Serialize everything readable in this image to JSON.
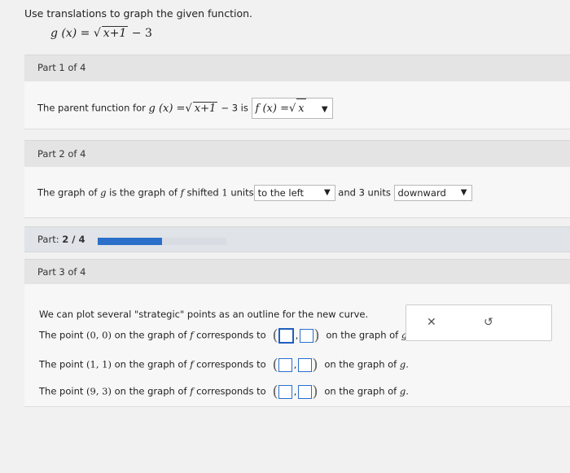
{
  "instructions": "Use translations to graph the given function.",
  "function": {
    "lhs": "g (x) =",
    "radicand": "x+1",
    "rest": "− 3"
  },
  "part1": {
    "label": "Part 1 of 4",
    "text_before": "The parent function for",
    "fn_lhs": "g (x) =",
    "fn_radicand": "x+1",
    "fn_rest": "− 3",
    "word_is": "is",
    "answer_lhs": "f (x) =",
    "answer_radicand": "x",
    "arrow": "▼"
  },
  "part2": {
    "label": "Part 2 of 4",
    "text_a": "The graph of",
    "var_g": "g",
    "text_b": "is the graph of",
    "var_f": "f",
    "text_c": "shifted",
    "h_units": "1",
    "text_d": "units",
    "h_direction": "to the left",
    "text_e": "and 3 units",
    "v_direction": "downward",
    "arrow": "▼"
  },
  "progress": {
    "label": "Part:",
    "value": "2 / 4",
    "fraction": 0.5
  },
  "part3": {
    "label": "Part 3 of 4",
    "intro": "We can plot several \"strategic\" points as an outline for the new curve.",
    "rows": [
      {
        "prefix": "The point",
        "point": "(0, 0)",
        "middle": "on the graph of",
        "fvar": "f",
        "corr": "corresponds to",
        "suffix": "on the graph of",
        "gvar": "g."
      },
      {
        "prefix": "The point",
        "point": "(1, 1)",
        "middle": "on the graph of",
        "fvar": "f",
        "corr": "corresponds to",
        "suffix": "on the graph of",
        "gvar": "g."
      },
      {
        "prefix": "The point",
        "point": "(9, 3)",
        "middle": "on the graph of",
        "fvar": "f",
        "corr": "corresponds to",
        "suffix": "on the graph of",
        "gvar": "g."
      }
    ]
  },
  "actions": {
    "clear": "✕",
    "undo": "↺"
  }
}
